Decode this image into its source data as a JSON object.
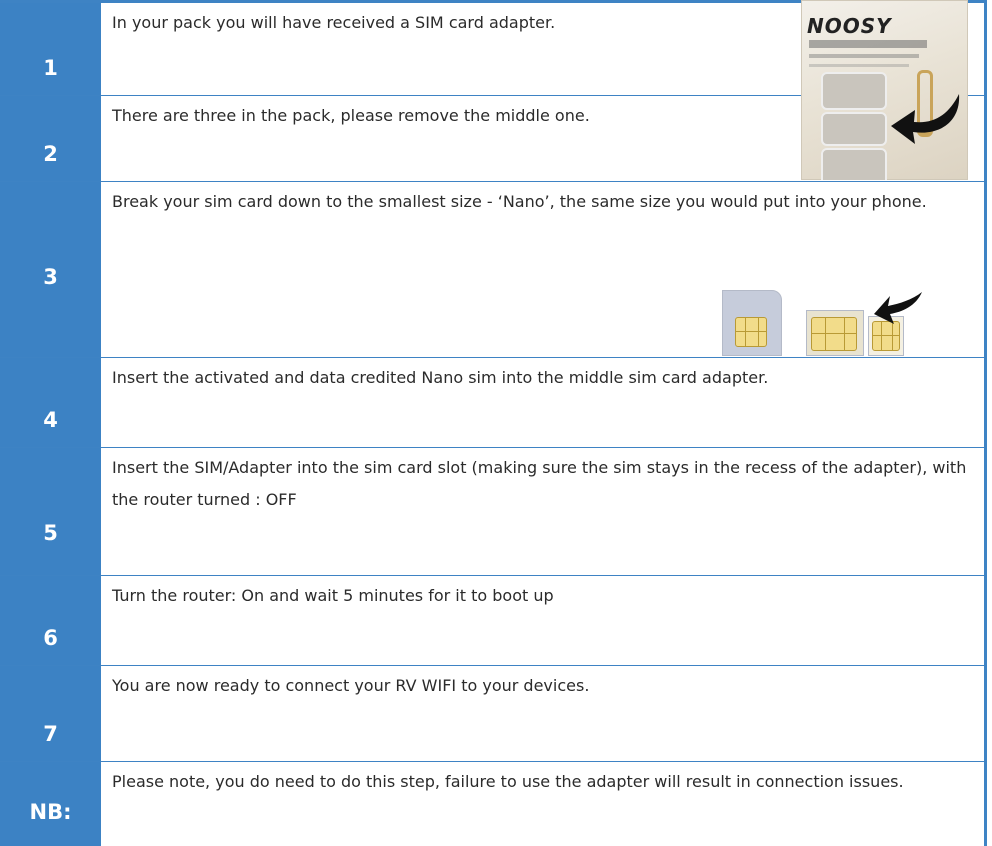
{
  "steps": [
    {
      "number": "1",
      "text": "In your pack you will have received a SIM card adapter."
    },
    {
      "number": "2",
      "text": "There are three in the pack, please remove the middle one."
    },
    {
      "number": "3",
      "text": "Break your sim card down to the smallest size - ‘Nano’, the same size you would put into your phone."
    },
    {
      "number": "4",
      "text": "Insert the activated and data credited Nano sim into the middle sim card adapter."
    },
    {
      "number": "5",
      "text": "Insert the SIM/Adapter into the sim card slot (making sure the sim stays in the recess of the adapter),  with the router turned : OFF"
    },
    {
      "number": "6",
      "text": "Turn the router: On and wait 5 minutes for it to boot up"
    },
    {
      "number": "7",
      "text": "You are now ready to connect your RV WIFI to your devices."
    },
    {
      "number": "NB:",
      "text": "Please note, you do need to do this step, failure to use the adapter will result in connection issues."
    }
  ],
  "images": {
    "adapter_pack_brand": "NOOSY"
  },
  "colors": {
    "accent_blue": "#3c82c4",
    "text": "#2b2b2b"
  }
}
